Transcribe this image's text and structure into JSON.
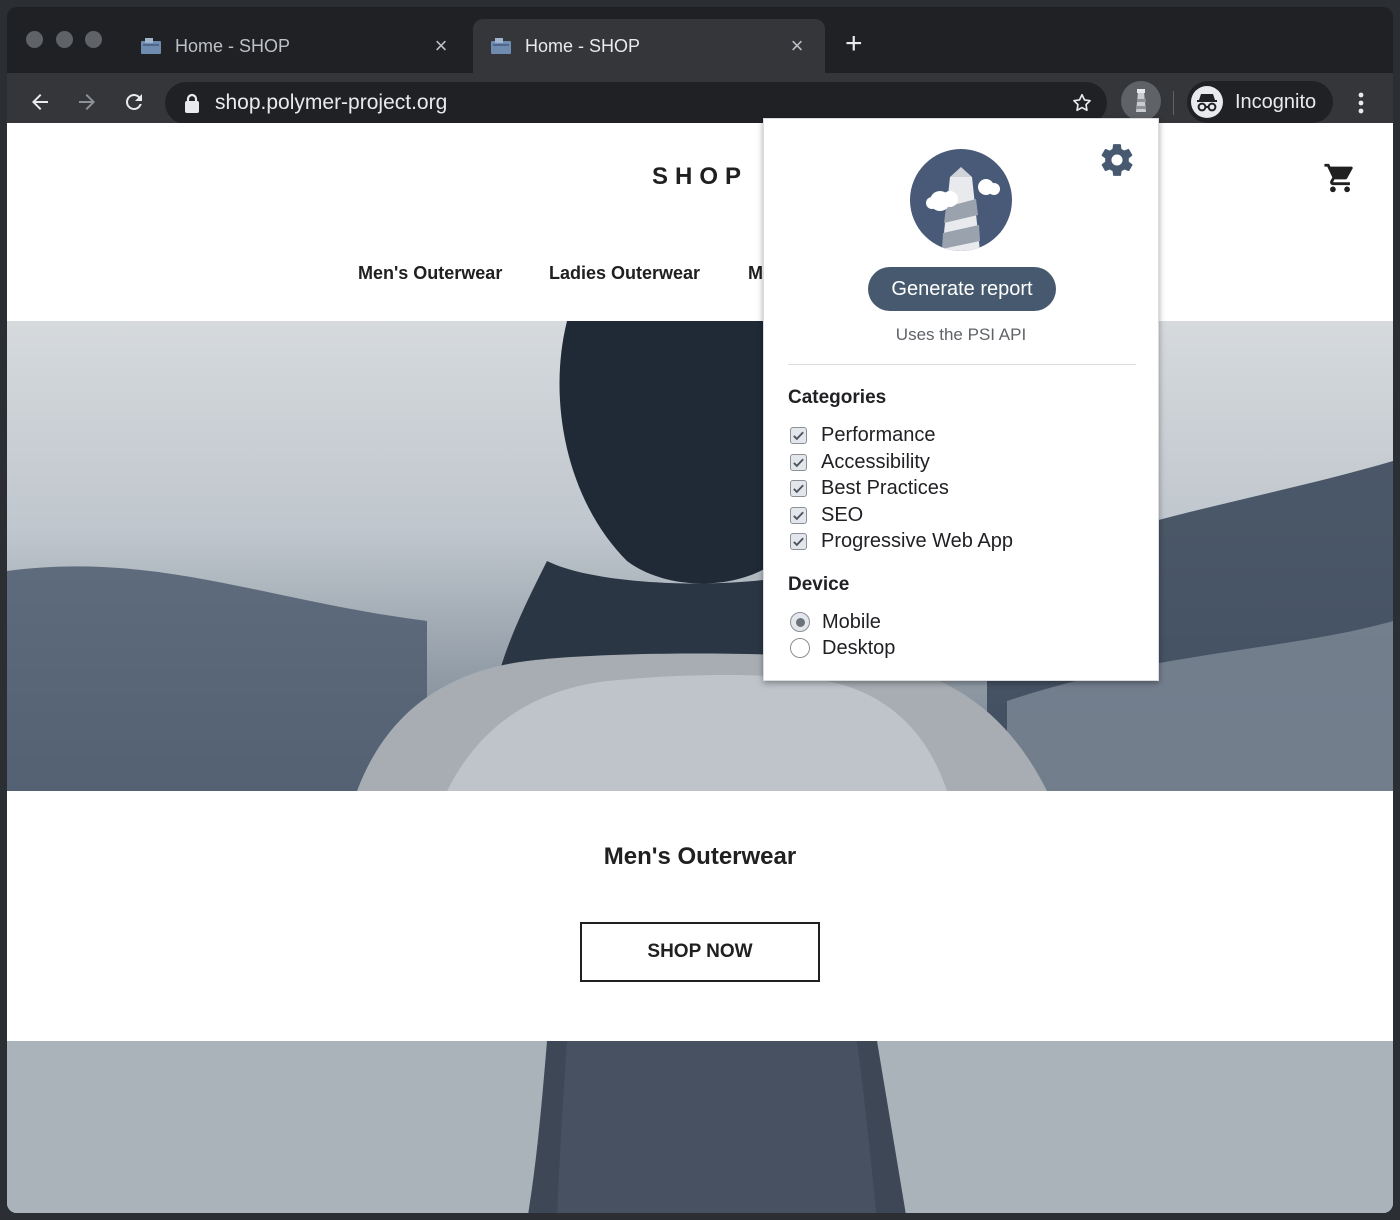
{
  "browser": {
    "tabs": [
      {
        "title": "Home - SHOP",
        "active": false
      },
      {
        "title": "Home - SHOP",
        "active": true
      }
    ],
    "new_tab": "+",
    "close_glyph": "×",
    "url": "shop.polymer-project.org",
    "profile_label": "Incognito"
  },
  "page": {
    "logo": "SHOP",
    "nav": [
      "Men's Outerwear",
      "Ladies Outerwear",
      "M"
    ],
    "hero_title": "Men's Outerwear",
    "cta": "SHOP NOW"
  },
  "popup": {
    "generate_label": "Generate report",
    "note": "Uses the PSI API",
    "categories_title": "Categories",
    "categories": [
      {
        "label": "Performance",
        "checked": true
      },
      {
        "label": "Accessibility",
        "checked": true
      },
      {
        "label": "Best Practices",
        "checked": true
      },
      {
        "label": "SEO",
        "checked": true
      },
      {
        "label": "Progressive Web App",
        "checked": true
      }
    ],
    "device_title": "Device",
    "devices": [
      {
        "label": "Mobile",
        "selected": true
      },
      {
        "label": "Desktop",
        "selected": false
      }
    ]
  },
  "colors": {
    "chrome_dark": "#202124",
    "chrome_toolbar": "#35363a",
    "button_accent": "#47596e",
    "logo_circle": "#485a78"
  },
  "icons": [
    "back-arrow-icon",
    "forward-arrow-icon",
    "reload-icon",
    "lock-icon",
    "star-icon",
    "lighthouse-extension-icon",
    "incognito-icon",
    "menu-kebab-icon",
    "cart-icon",
    "gear-icon",
    "lighthouse-logo-icon",
    "checkmark-icon"
  ]
}
